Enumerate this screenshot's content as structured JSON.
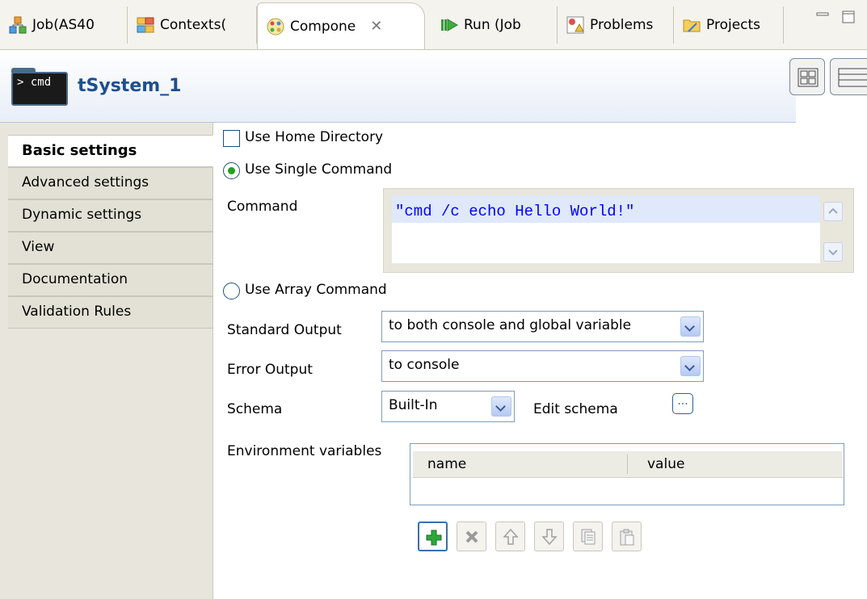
{
  "tabs": [
    {
      "label": "Job(AS40",
      "icon": "job-icon"
    },
    {
      "label": "Contexts(",
      "icon": "contexts-icon"
    },
    {
      "label": "Compone",
      "icon": "component-icon",
      "active": true
    },
    {
      "label": "Run (Job",
      "icon": "run-icon"
    },
    {
      "label": "Problems",
      "icon": "problems-icon"
    },
    {
      "label": "Projects",
      "icon": "projects-icon"
    }
  ],
  "header": {
    "icon_text": "> cmd",
    "title": "tSystem_1"
  },
  "sidebar": {
    "items": [
      {
        "label": "Basic settings",
        "active": true
      },
      {
        "label": "Advanced settings"
      },
      {
        "label": "Dynamic settings"
      },
      {
        "label": "View"
      },
      {
        "label": "Documentation"
      },
      {
        "label": "Validation Rules"
      }
    ]
  },
  "form": {
    "use_home_directory": {
      "label": "Use Home Directory",
      "checked": false
    },
    "use_single_command": {
      "label": "Use Single Command",
      "selected": true
    },
    "command": {
      "label": "Command",
      "value": "\"cmd /c echo Hello World!\""
    },
    "use_array_command": {
      "label": "Use Array Command",
      "selected": false
    },
    "standard_output": {
      "label": "Standard Output",
      "value": "to both console and global variable"
    },
    "error_output": {
      "label": "Error Output",
      "value": "to console"
    },
    "schema": {
      "label": "Schema",
      "value": "Built-In",
      "edit_label": "Edit schema",
      "edit_button": "..."
    },
    "environment_variables": {
      "label": "Environment variables",
      "columns": [
        "name",
        "value"
      ],
      "rows": []
    }
  },
  "toolbar": {
    "buttons": [
      {
        "name": "add-row-button",
        "icon": "plus-icon",
        "enabled": true
      },
      {
        "name": "remove-row-button",
        "icon": "delete-icon",
        "enabled": false
      },
      {
        "name": "move-up-button",
        "icon": "arrow-up-icon",
        "enabled": false
      },
      {
        "name": "move-down-button",
        "icon": "arrow-down-icon",
        "enabled": false
      },
      {
        "name": "copy-button",
        "icon": "copy-icon",
        "enabled": false
      },
      {
        "name": "paste-button",
        "icon": "paste-icon",
        "enabled": false
      }
    ]
  },
  "colors": {
    "title_blue": "#1f4f8e",
    "command_text": "#0000ff",
    "radio_selected": "#21a121",
    "add_button_green": "#2ea83a"
  }
}
